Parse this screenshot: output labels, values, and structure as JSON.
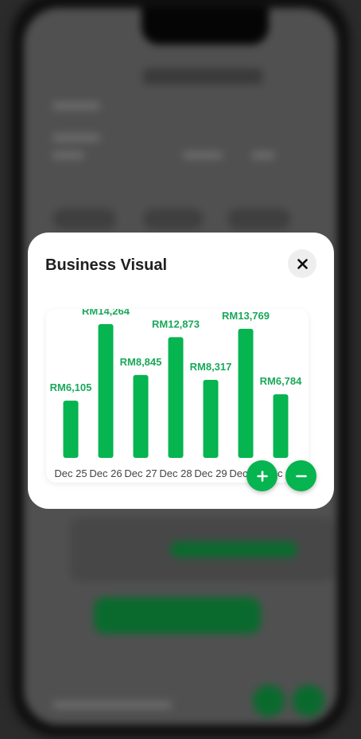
{
  "modal": {
    "title": "Business Visual"
  },
  "chart_data": {
    "type": "bar",
    "categories": [
      "Dec 25",
      "Dec 26",
      "Dec 27",
      "Dec 28",
      "Dec 29",
      "Dec 30",
      "Dec 31"
    ],
    "values": [
      6105,
      14264,
      8845,
      12873,
      8317,
      13769,
      6784
    ],
    "data_labels": [
      "RM6,105",
      "RM14,264",
      "RM8,845",
      "RM12,873",
      "RM8,317",
      "RM13,769",
      "RM6,784"
    ],
    "title": "",
    "xlabel": "",
    "ylabel": "",
    "ylim": [
      0,
      14264
    ],
    "grid": false,
    "color": "#06b450"
  },
  "controls": {
    "zoom_in": "plus-icon",
    "zoom_out": "minus-icon"
  },
  "colors": {
    "accent": "#06b450",
    "label": "#1aa85a",
    "tick": "#444444"
  }
}
